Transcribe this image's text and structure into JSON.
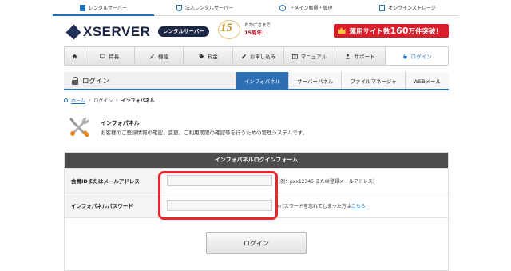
{
  "top_nav": [
    {
      "label": "レンタルサーバー",
      "icon": "server-icon",
      "color": "#1d6fb8",
      "active": true
    },
    {
      "label": "法人レンタルサーバー",
      "icon": "shield-icon",
      "color": "#1d6fb8",
      "active": false
    },
    {
      "label": "ドメイン取得・管理",
      "icon": "globe-icon",
      "color": "#1d6fb8",
      "active": false
    },
    {
      "label": "オンラインストレージ",
      "icon": "storage-icon",
      "color": "#1d6fb8",
      "active": false
    }
  ],
  "header": {
    "logo_text": "XSERVER",
    "logo_badge": "レンタルサーバー",
    "anniversary_number": "15",
    "anniversary_line1": "おかげさまで",
    "anniversary_line2": "15周年!",
    "promo_prefix": "運用サイト数",
    "promo_number": "160",
    "promo_suffix": "万件突破！",
    "brand_color": "#1b2544",
    "promo_color": "#d91d2a"
  },
  "main_nav": [
    {
      "label": "",
      "icon": "home-icon",
      "width": 26
    },
    {
      "label": "特長",
      "icon": "monitor-icon",
      "width": 62
    },
    {
      "label": "機能",
      "icon": "wand-icon",
      "width": 62
    },
    {
      "label": "料金",
      "icon": "tag-icon",
      "width": 62
    },
    {
      "label": "お申し込み",
      "icon": "pencil-icon",
      "width": 64
    },
    {
      "label": "マニュアル",
      "icon": "book-icon",
      "width": 64
    },
    {
      "label": "サポート",
      "icon": "person-icon",
      "width": 64
    },
    {
      "label": "ログイン",
      "icon": "lock-icon",
      "width": 78,
      "active": true
    }
  ],
  "login_bar": {
    "title": "ログイン",
    "tabs": [
      {
        "label": "インフォパネル",
        "active": true
      },
      {
        "label": "サーバーパネル",
        "active": false
      },
      {
        "label": "ファイルマネージャ",
        "active": false
      },
      {
        "label": "WEBメール",
        "active": false
      }
    ]
  },
  "breadcrumb": {
    "home": "ホーム",
    "sep1": "›",
    "login": "ログイン",
    "sep2": "›",
    "current": "インフォパネル"
  },
  "intro": {
    "title": "インフォパネル",
    "description": "お客様のご登録情報の確認、変更、ご利用期限の確認等を行うための管理システムです。"
  },
  "form": {
    "header": "インフォパネルログインフォーム",
    "id_label": "会員IDまたはメールアドレス",
    "id_value": "",
    "id_hint": "（例：pxx12345 または登録メールアドレス）",
    "password_label": "インフォパネルパスワード",
    "password_value": "",
    "password_hint": "※パスワードを忘れてしまった方は",
    "password_link": "こちら",
    "submit_label": "ログイン"
  },
  "colors": {
    "accent": "#2d6fb4",
    "highlight": "#e8262a"
  }
}
